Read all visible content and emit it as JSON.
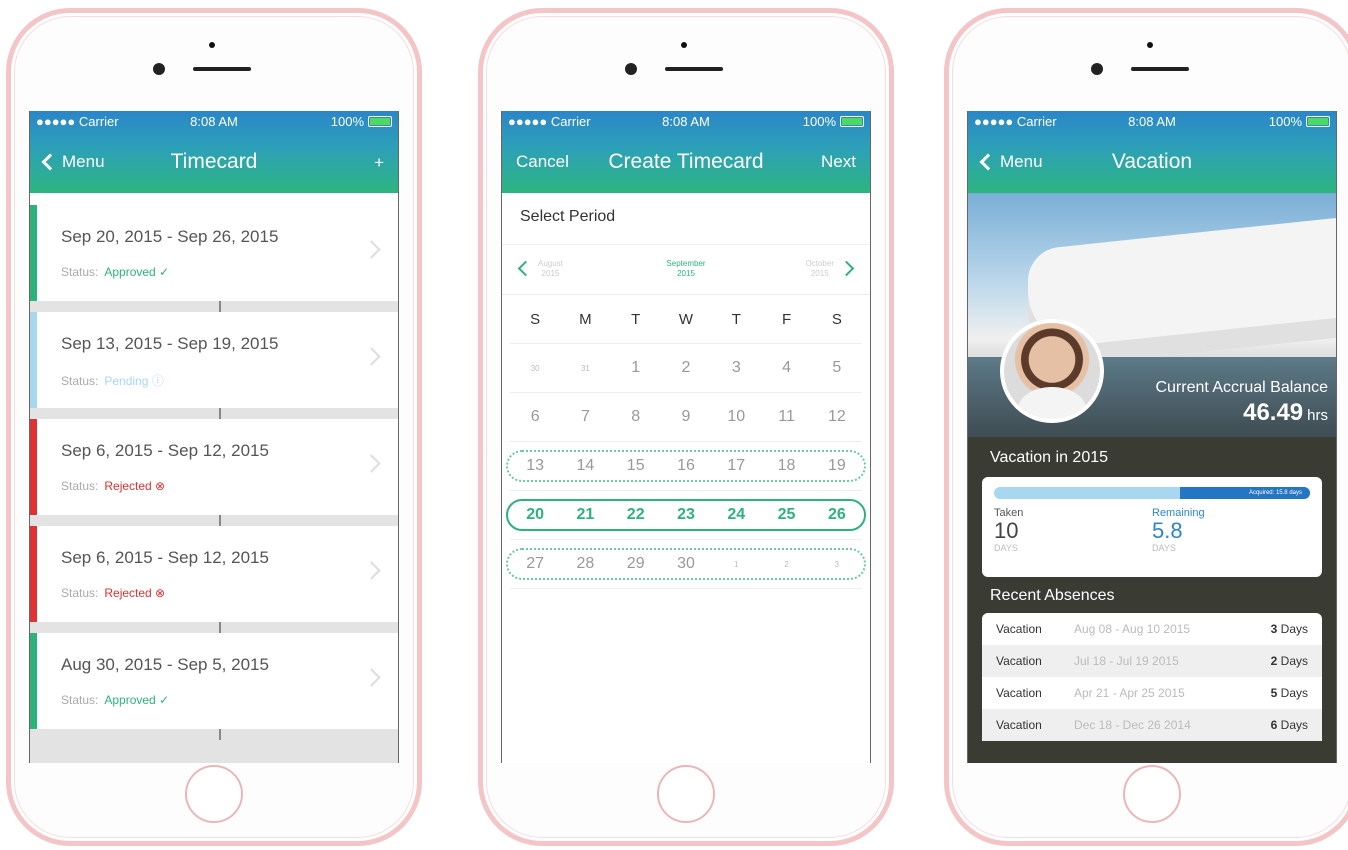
{
  "status_bar": {
    "carrier": "●●●●● Carrier",
    "time": "8:08 AM",
    "battery": "100%"
  },
  "timecard": {
    "back_label": "Menu",
    "title": "Timecard",
    "add_label": "+",
    "status_label": "Status:",
    "items": [
      {
        "dates": "Sep 20, 2015 - Sep 26, 2015",
        "status": "Approved ✓",
        "color": "#2db37a"
      },
      {
        "dates": "Sep 13, 2015 - Sep 19, 2015",
        "status": "Pending ⓘ",
        "color": "#a8d7f0"
      },
      {
        "dates": "Sep 6, 2015 - Sep 12, 2015",
        "status": "Rejected ⊗",
        "color": "#e03232"
      },
      {
        "dates": "Sep 6, 2015 - Sep 12, 2015",
        "status": "Rejected ⊗",
        "color": "#e03232"
      },
      {
        "dates": "Aug 30, 2015 - Sep 5, 2015",
        "status": "Approved ✓",
        "color": "#2db37a"
      }
    ]
  },
  "create": {
    "cancel_label": "Cancel",
    "title": "Create Timecard",
    "next_label": "Next",
    "select_period": "Select Period",
    "prev_month": "August",
    "prev_year": "2015",
    "cur_month": "September",
    "cur_year": "2015",
    "next_month": "October",
    "next_year": "2015",
    "weekdays": [
      "S",
      "M",
      "T",
      "W",
      "T",
      "F",
      "S"
    ],
    "weeks": [
      [
        "30",
        "31",
        "1",
        "2",
        "3",
        "4",
        "5"
      ],
      [
        "6",
        "7",
        "8",
        "9",
        "10",
        "11",
        "12"
      ],
      [
        "13",
        "14",
        "15",
        "16",
        "17",
        "18",
        "19"
      ],
      [
        "20",
        "21",
        "22",
        "23",
        "24",
        "25",
        "26"
      ],
      [
        "27",
        "28",
        "29",
        "30",
        "1",
        "2",
        "3"
      ]
    ]
  },
  "vacation": {
    "back_label": "Menu",
    "title": "Vacation",
    "accrual_label": "Current Accrual Balance",
    "accrual_value": "46.49",
    "accrual_unit": "hrs",
    "year_heading": "Vacation in 2015",
    "acquired_label": "Acquired: 15.8 days",
    "acquired_fraction": 0.41,
    "taken_label": "Taken",
    "taken_value": "10",
    "taken_unit": "DAYS",
    "remaining_label": "Remaining",
    "remaining_value": "5.8",
    "remaining_unit": "DAYS",
    "recent_heading": "Recent Absences",
    "absences": [
      {
        "type": "Vacation",
        "range": "Aug 08 - Aug 10 2015",
        "days": "3",
        "unit": "Days"
      },
      {
        "type": "Vacation",
        "range": "Jul 18 - Jul 19 2015",
        "days": "2",
        "unit": "Days"
      },
      {
        "type": "Vacation",
        "range": "Apr 21 - Apr 25 2015",
        "days": "5",
        "unit": "Days"
      },
      {
        "type": "Vacation",
        "range": "Dec 18 - Dec 26 2014",
        "days": "6",
        "unit": "Days"
      }
    ]
  }
}
